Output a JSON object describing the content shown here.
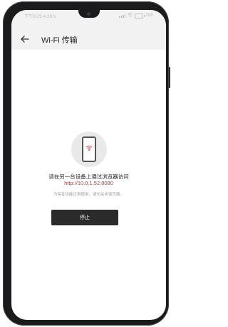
{
  "status_bar": {
    "time": "下午3:25",
    "network_speed": "4.2K/s",
    "battery": "290"
  },
  "toolbar": {
    "back_icon": "arrow-left-icon",
    "title": "Wi-Fi 传输"
  },
  "main": {
    "illustration_icon": "phone-wifi-icon",
    "instruction": "请在另一台设备上通过浏览器访问",
    "url": "http://10.0.1.52:8080",
    "hint": "为保证功能正常使用，请勿关闭该页面。",
    "stop_label": "停止"
  },
  "colors": {
    "url": "#d32f2f",
    "button_bg": "#2b2b2b",
    "header_bg": "#f2f2f2"
  }
}
